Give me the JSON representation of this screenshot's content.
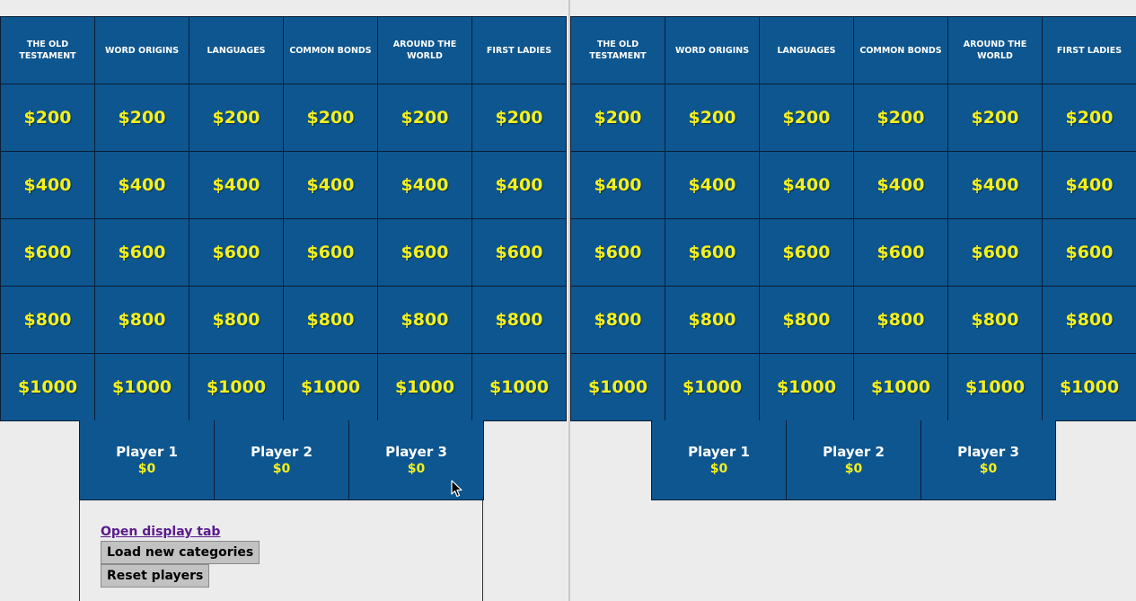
{
  "categories": [
    "THE OLD TESTAMENT",
    "WORD ORIGINS",
    "LANGUAGES",
    "COMMON BONDS",
    "AROUND THE WORLD",
    "FIRST LADIES"
  ],
  "values": [
    "$200",
    "$400",
    "$600",
    "$800",
    "$1000"
  ],
  "players": [
    {
      "name": "Player 1",
      "score": "$0"
    },
    {
      "name": "Player 2",
      "score": "$0"
    },
    {
      "name": "Player 3",
      "score": "$0"
    }
  ],
  "controls": {
    "open_display_tab": "Open display tab",
    "load_new_categories": "Load new categories",
    "reset_players": "Reset players"
  },
  "colors": {
    "tile": "#0d5690",
    "value_text": "#f4f01e",
    "category_text": "#ffffff",
    "link": "#5a1a8c"
  }
}
